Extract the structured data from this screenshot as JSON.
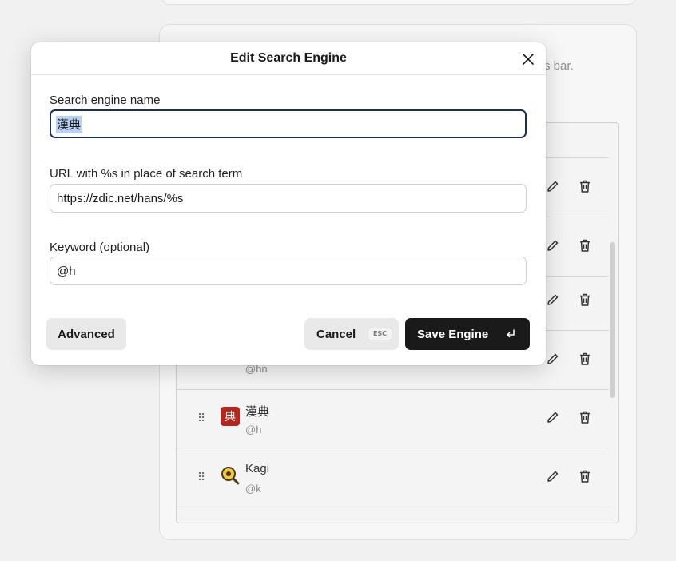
{
  "modal": {
    "title": "Edit Search Engine",
    "name_label": "Search engine name",
    "name_value": "漢典",
    "url_label": "URL with %s in place of search term",
    "url_value": "https://zdic.net/hans/%s",
    "keyword_label": "Keyword (optional)",
    "keyword_value": "@h",
    "advanced_label": "Advanced",
    "cancel_label": "Cancel",
    "cancel_shortcut": "ESC",
    "save_label": "Save Engine"
  },
  "background": {
    "description_fragment": "s bar.",
    "engines": [
      {
        "name": "",
        "keyword": "@hn"
      },
      {
        "name": "漢典",
        "keyword": "@h",
        "icon_glyph": "典"
      },
      {
        "name": "Kagi",
        "keyword": "@k"
      }
    ]
  },
  "colors": {
    "accent": "#2d55c8",
    "focus_border": "#1e2f55",
    "selection": "#b9d1f5",
    "primary_button": "#1a1a1a"
  }
}
